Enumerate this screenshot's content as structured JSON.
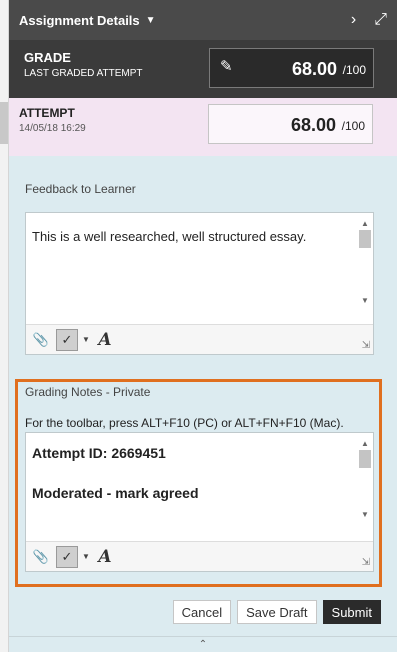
{
  "header": {
    "title": "Assignment Details",
    "chevron_icon": "chevron-down-icon",
    "next_icon": "chevron-right-icon",
    "expand_icon": "expand-icon"
  },
  "grade": {
    "label": "GRADE",
    "sublabel": "LAST GRADED ATTEMPT",
    "value": "68.00",
    "max": "/100"
  },
  "attempt": {
    "label": "ATTEMPT",
    "date": "14/05/18 16:29",
    "value": "68.00",
    "max": "/100"
  },
  "feedback": {
    "label": "Feedback to Learner",
    "text": "This is a well researched, well structured essay."
  },
  "grading_notes": {
    "label": "Grading Notes - Private",
    "hint": "For the toolbar, press ALT+F10 (PC) or ALT+FN+F10 (Mac).",
    "line1": "Attempt ID: 2669451",
    "line2": "Moderated - mark agreed"
  },
  "actions": {
    "cancel": "Cancel",
    "save_draft": "Save Draft",
    "submit": "Submit"
  },
  "colors": {
    "header_bg": "#4a4a4a",
    "grade_bg": "#3b3b3b",
    "attempt_bg": "#f3e4f2",
    "panel_bg": "#dcebf0",
    "highlight_border": "#e06f1f"
  }
}
